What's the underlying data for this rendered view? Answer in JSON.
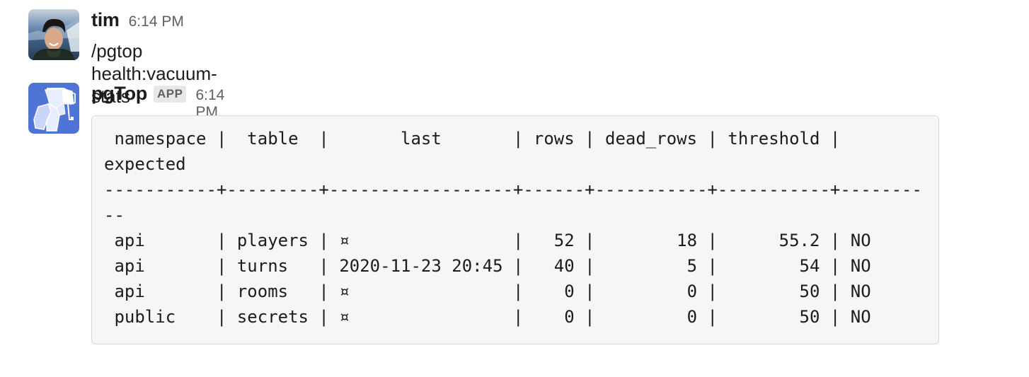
{
  "messages": [
    {
      "sender": "tim",
      "timestamp": "6:14 PM",
      "avatar": "user-photo-avatar",
      "text": "/pgtop health:vacuum-stats"
    },
    {
      "sender": "pgTop",
      "badge": "APP",
      "timestamp": "6:14 PM",
      "avatar": "elephant-logo-icon",
      "code_block": {
        "header_line": " namespace |  table  |       last       | rows | dead_rows | threshold |",
        "header_wrap": "expected",
        "separator_line": "-----------+---------+------------------+------+-----------+-----------+--------",
        "separator_wrap": "--",
        "columns": [
          "namespace",
          "table",
          "last",
          "rows",
          "dead_rows",
          "threshold",
          "expected"
        ],
        "rows": [
          {
            "namespace": "api",
            "table": "players",
            "last": "¤",
            "rows": "52",
            "dead_rows": "18",
            "threshold": "55.2",
            "expected": "NO",
            "line": " api       | players | ¤                |   52 |        18 |      55.2 | NO"
          },
          {
            "namespace": "api",
            "table": "turns",
            "last": "2020-11-23 20:45",
            "rows": "40",
            "dead_rows": "5",
            "threshold": "54",
            "expected": "NO",
            "line": " api       | turns   | 2020-11-23 20:45 |   40 |         5 |        54 | NO"
          },
          {
            "namespace": "api",
            "table": "rooms",
            "last": "¤",
            "rows": "0",
            "dead_rows": "0",
            "threshold": "50",
            "expected": "NO",
            "line": " api       | rooms   | ¤                |    0 |         0 |        50 | NO"
          },
          {
            "namespace": "public",
            "table": "secrets",
            "last": "¤",
            "rows": "0",
            "dead_rows": "0",
            "threshold": "50",
            "expected": "NO",
            "line": " public    | secrets | ¤                |    0 |         0 |        50 | NO"
          }
        ]
      }
    }
  ],
  "colors": {
    "avatar_brand_blue": "#4f74d6",
    "code_bg": "#f6f6f6",
    "badge_bg": "#e8e8e8",
    "muted_text": "#616061"
  }
}
